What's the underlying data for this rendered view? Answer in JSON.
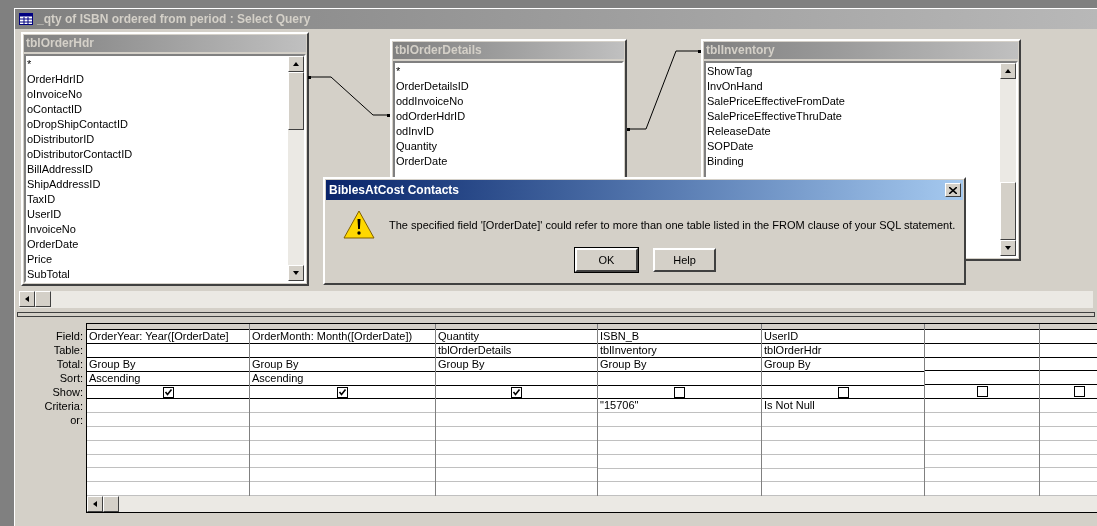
{
  "window": {
    "title": "_qty of ISBN ordered from period : Select Query"
  },
  "tables": [
    {
      "name": "tblOrderHdr",
      "fields": [
        "*",
        "OrderHdrID",
        "oInvoiceNo",
        "oContactID",
        "oDropShipContactID",
        "oDistributorID",
        "oDistributorContactID",
        "BillAddressID",
        "ShipAddressID",
        "TaxID",
        "UserID",
        "InvoiceNo",
        "OrderDate",
        "Price",
        "SubTotal"
      ]
    },
    {
      "name": "tblOrderDetails",
      "fields": [
        "*",
        "OrderDetailsID",
        "oddInvoiceNo",
        "odOrderHdrID",
        "odInvID",
        "Quantity",
        "OrderDate"
      ]
    },
    {
      "name": "tblInventory",
      "fields": [
        "ShowTag",
        "InvOnHand",
        "SalePriceEffectiveFromDate",
        "SalePriceEffectiveThruDate",
        "ReleaseDate",
        "SOPDate",
        "Binding"
      ]
    }
  ],
  "dialog": {
    "title": "BiblesAtCost Contacts",
    "message": "The specified field '[OrderDate]' could refer to more than one table listed in the FROM clause of your SQL statement.",
    "buttons": [
      "OK",
      "Help"
    ]
  },
  "grid": {
    "row_labels": [
      "Field:",
      "Table:",
      "Total:",
      "Sort:",
      "Show:",
      "Criteria:",
      "or:"
    ],
    "columns": [
      {
        "field": "OrderYear: Year([OrderDate]",
        "total": "Group By",
        "sort": "Ascending",
        "show": true
      },
      {
        "field": "OrderMonth: Month([OrderDate])",
        "total": "Group By",
        "sort": "Ascending",
        "show": true
      },
      {
        "field": "Quantity",
        "table": "tblOrderDetails",
        "total": "Group By",
        "show": true
      },
      {
        "field": "ISBN_B",
        "table": "tblInventory",
        "total": "Group By",
        "show": false,
        "criteria": "\"15706\""
      },
      {
        "field": "UserID",
        "table": "tblOrderHdr",
        "total": "Group By",
        "show": false,
        "criteria": "Is Not Null"
      },
      {
        "show": false
      },
      {
        "show": false
      }
    ]
  }
}
